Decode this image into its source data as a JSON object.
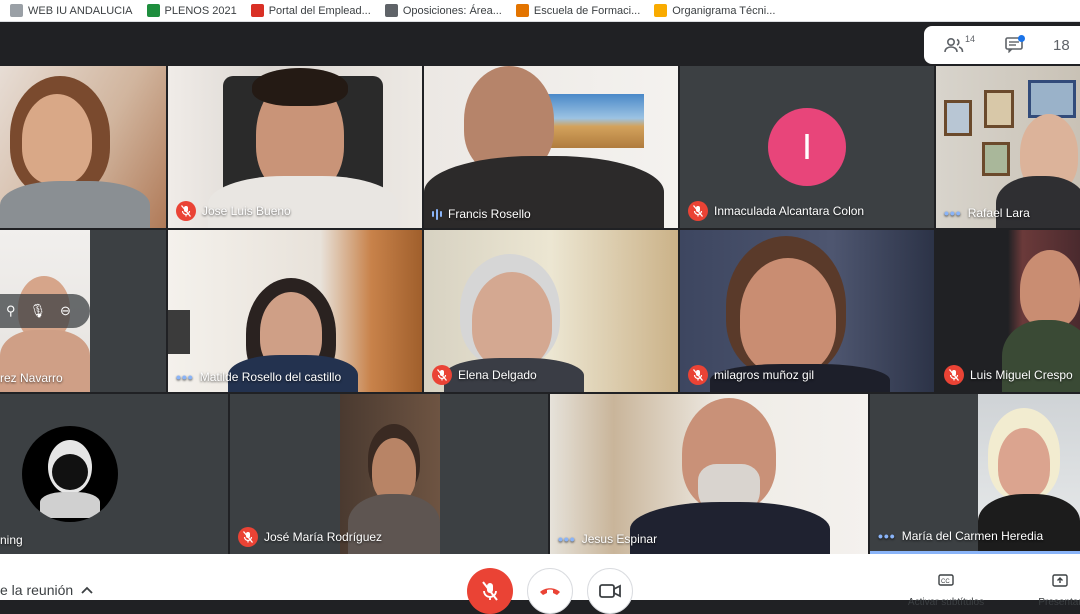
{
  "bookmarks": [
    {
      "label": "WEB IU ANDALUCIA",
      "color": "#6d6d6d"
    },
    {
      "label": "PLENOS 2021",
      "color": "#1e8e3e"
    },
    {
      "label": "Portal del Emplead...",
      "color": "#d93025"
    },
    {
      "label": "Oposiciones: Área...",
      "color": "#5f6368"
    },
    {
      "label": "Escuela de Formaci...",
      "color": "#e37400"
    },
    {
      "label": "Organigrama Técni...",
      "color": "#f9ab00"
    }
  ],
  "people_panel": {
    "participants_count": "14",
    "clock": "18"
  },
  "tiles": {
    "t1": {
      "name": ""
    },
    "t2": {
      "name": "Jose Luis Bueno"
    },
    "t3": {
      "name": "Francis Rosello"
    },
    "t4": {
      "name": "Inmaculada Alcantara Colon",
      "avatar_letter": "I"
    },
    "t5": {
      "name": "Rafael Lara"
    },
    "t6": {
      "name": "rez Navarro"
    },
    "t7": {
      "name": "Matilde Rosello del castillo"
    },
    "t8": {
      "name": "Elena Delgado"
    },
    "t9": {
      "name": "milagros muñoz gil"
    },
    "t10": {
      "name": "Luis Miguel Crespo"
    },
    "t11": {
      "name": "ning"
    },
    "t12": {
      "name": "José María Rodríguez"
    },
    "t13": {
      "name": "Jesus Espinar"
    },
    "t14": {
      "name": "María del Carmen Heredia"
    }
  },
  "bottom": {
    "meeting_details": "e la reunión",
    "captions_label": "Activar subtítulos",
    "present_label": "Presentar"
  },
  "colors": {
    "mic_off": "#ea4335",
    "avatar": "#e8457a",
    "accent": "#8ab4f8"
  }
}
